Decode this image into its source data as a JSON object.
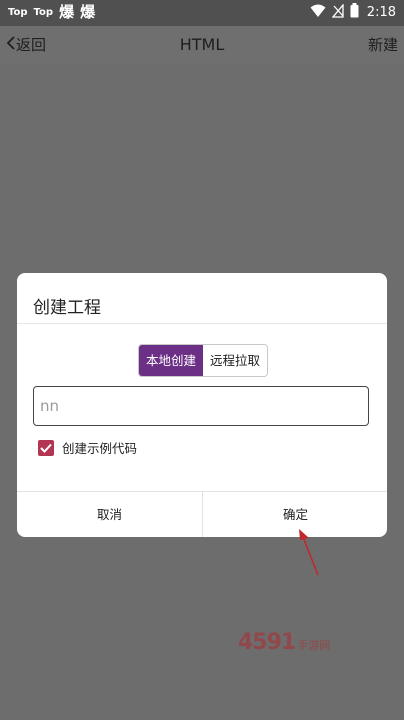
{
  "status_bar": {
    "app_labels": [
      "Top",
      "Top"
    ],
    "glyphs": [
      "爆",
      "爆"
    ],
    "time": "2:18",
    "icons": [
      "wifi-icon",
      "signal-off-icon",
      "battery-icon"
    ]
  },
  "app_bar": {
    "back_label": "返回",
    "title": "HTML",
    "new_label": "新建"
  },
  "dialog": {
    "title": "创建工程",
    "segments": {
      "local": "本地创建",
      "remote": "远程拉取",
      "selected": "local"
    },
    "name_input_value": "nn",
    "checkbox": {
      "label": "创建示例代码",
      "checked": true
    },
    "cancel_label": "取消",
    "ok_label": "确定"
  },
  "watermark": {
    "number": "4591",
    "text": "手游网"
  },
  "colors": {
    "overlay": "#6d6d6d",
    "status_bar": "#505050",
    "accent_purple": "#6b2f86",
    "checkbox": "#b23553",
    "arrow": "#c0282c"
  }
}
